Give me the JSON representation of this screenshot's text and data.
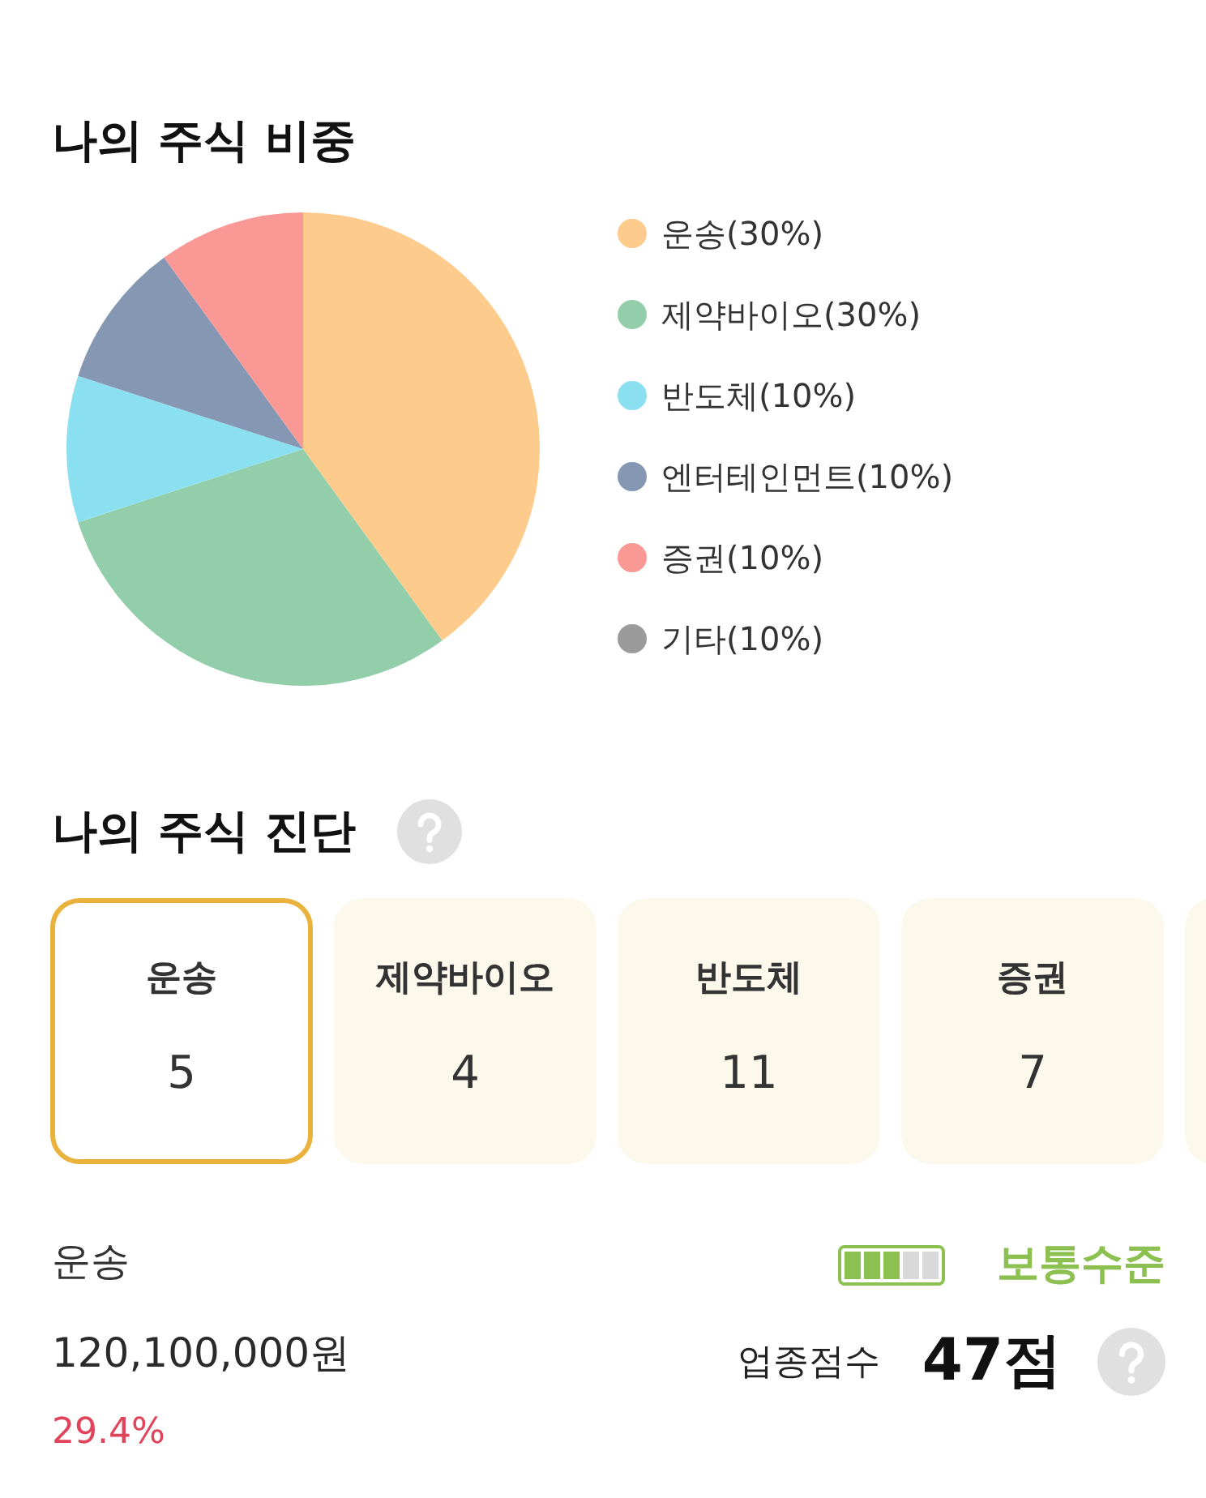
{
  "allocation": {
    "title": "나의 주식 비중",
    "chart_data": {
      "type": "pie",
      "categories": [
        "운송(30%)",
        "제약바이오(30%)",
        "반도체(10%)",
        "엔터테인먼트(10%)",
        "증권(10%)",
        "기타(10%)"
      ],
      "values": [
        40,
        30,
        10,
        10,
        10,
        0
      ],
      "colors": [
        "#fdcb8b",
        "#93ceab",
        "#8ae0f0",
        "#8597b3",
        "#fa9896",
        "#9b9b9b"
      ],
      "legend": "right"
    }
  },
  "diagnosis": {
    "title": "나의 주식 진단",
    "cards": [
      {
        "label": "운송",
        "value": "5",
        "selected": true
      },
      {
        "label": "제약바이오",
        "value": "4",
        "selected": false
      },
      {
        "label": "반도체",
        "value": "11",
        "selected": false
      },
      {
        "label": "증권",
        "value": "7",
        "selected": false
      },
      {
        "selected": false
      }
    ]
  },
  "detail": {
    "sector": "운송",
    "amount": "120,100,000원",
    "share": "29.4%",
    "meter": {
      "level": 0.6
    },
    "grade": "보통수준",
    "score_label": "업종점수",
    "score": "47점"
  }
}
